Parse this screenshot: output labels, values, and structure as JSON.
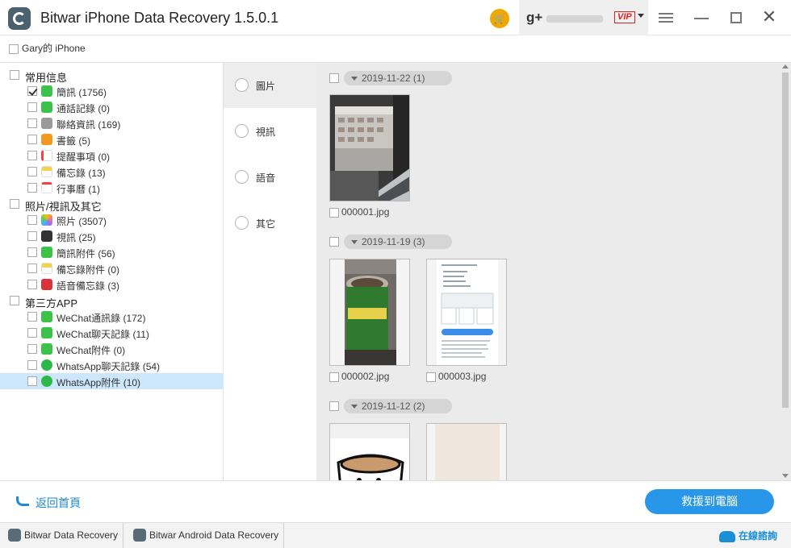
{
  "app": {
    "title": "Bitwar iPhone Data Recovery  1.5.0.1",
    "vip_label": "VIP",
    "gplus_label": "g+"
  },
  "device": {
    "name": "Gary的 iPhone"
  },
  "tree": {
    "groups": [
      {
        "label": "常用信息",
        "items": [
          {
            "label": "簡訊 (1756)",
            "checked": true,
            "icon": "messages-icon",
            "color": "#3cc24a"
          },
          {
            "label": "通話記錄 (0)",
            "checked": false,
            "icon": "phone-icon",
            "color": "#3cc24a"
          },
          {
            "label": "聯絡資訊 (169)",
            "checked": false,
            "icon": "contacts-icon",
            "color": "#9a9a9a"
          },
          {
            "label": "書籤 (5)",
            "checked": false,
            "icon": "bookmarks-icon",
            "color": "#f29a1f"
          },
          {
            "label": "提醒事項 (0)",
            "checked": false,
            "icon": "reminders-icon",
            "color": "#e0e0e0"
          },
          {
            "label": "備忘錄 (13)",
            "checked": false,
            "icon": "notes-icon",
            "color": "#f3d34a"
          },
          {
            "label": "行事曆 (1)",
            "checked": false,
            "icon": "calendar-icon",
            "color": "#ffffff"
          }
        ]
      },
      {
        "label": "照片/視訊及其它",
        "items": [
          {
            "label": "照片 (3507)",
            "checked": false,
            "icon": "photos-icon",
            "color": "#f07a8a"
          },
          {
            "label": "視訊 (25)",
            "checked": false,
            "icon": "videos-icon",
            "color": "#333333"
          },
          {
            "label": "簡訊附件 (56)",
            "checked": false,
            "icon": "message-attachments-icon",
            "color": "#3cc24a"
          },
          {
            "label": "備忘錄附件 (0)",
            "checked": false,
            "icon": "notes-attachments-icon",
            "color": "#f3d34a"
          },
          {
            "label": "語音備忘錄 (3)",
            "checked": false,
            "icon": "voice-memos-icon",
            "color": "#d9343a"
          }
        ]
      },
      {
        "label": "第三方APP",
        "items": [
          {
            "label": "WeChat通訊錄 (172)",
            "checked": false,
            "icon": "wechat-contacts-icon",
            "color": "#3cc24a"
          },
          {
            "label": "WeChat聊天記錄 (11)",
            "checked": false,
            "icon": "wechat-chat-icon",
            "color": "#3cc24a"
          },
          {
            "label": "WeChat附件 (0)",
            "checked": false,
            "icon": "wechat-attachments-icon",
            "color": "#3cc24a"
          },
          {
            "label": "WhatsApp聊天記錄 (54)",
            "checked": false,
            "icon": "whatsapp-chat-icon",
            "color": "#2fb84a"
          },
          {
            "label": "WhatsApp附件 (10)",
            "checked": false,
            "icon": "whatsapp-attachments-icon",
            "color": "#2fb84a",
            "selected": true
          }
        ]
      }
    ]
  },
  "categories": [
    {
      "label": "圖片",
      "active": true
    },
    {
      "label": "視訊",
      "active": false
    },
    {
      "label": "語音",
      "active": false
    },
    {
      "label": "其它",
      "active": false
    }
  ],
  "date_groups": [
    {
      "label": "2019-11-22 (1)",
      "files": [
        "000001.jpg"
      ]
    },
    {
      "label": "2019-11-19 (3)",
      "files": [
        "000002.jpg",
        "000003.jpg"
      ]
    },
    {
      "label": "2019-11-12 (2)",
      "files": [
        "",
        ""
      ]
    }
  ],
  "actions": {
    "back_label": "返回首頁",
    "recover_label": "救援到電腦"
  },
  "footer": {
    "tabs": [
      "Bitwar Data Recovery",
      "Bitwar Android Data Recovery"
    ],
    "online_label": "在線諮詢"
  },
  "colors": {
    "accent": "#2897ea",
    "selected_row": "#cce6fb",
    "cart": "#f0a800",
    "vip": "#dd2222"
  }
}
